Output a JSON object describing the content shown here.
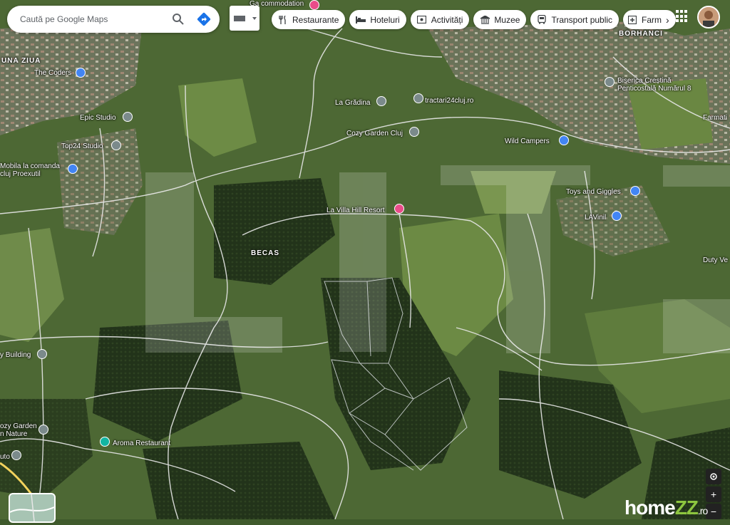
{
  "search": {
    "placeholder": "Caută pe Google Maps"
  },
  "chips": [
    {
      "label": "Restaurante",
      "icon": "fork-knife-icon"
    },
    {
      "label": "Hoteluri",
      "icon": "bed-icon"
    },
    {
      "label": "Activități",
      "icon": "ticket-icon"
    },
    {
      "label": "Muzee",
      "icon": "museum-icon"
    },
    {
      "label": "Transport public",
      "icon": "bus-icon"
    },
    {
      "label": "Farm",
      "icon": "pharmacy-icon"
    }
  ],
  "more_chip_arrow": "›",
  "areas": {
    "una_ziua": "UNA ZIUA",
    "borhanci": "BORHANCI",
    "becas": "BECAS"
  },
  "places": {
    "top_commodation": "Ga commodation",
    "the_coders": "The Coders",
    "epic_studio": "Epic Studio",
    "top24": "Top24 Studio",
    "mobila1": "Mobila la comanda",
    "mobila2": "cluj Proexutil",
    "la_gradina": "La Grădina",
    "tractari": "tractari24cluj.ro",
    "cozy": "Cozy Garden Cluj",
    "biserica1": "Biserica Creștină",
    "biserica2": "Penticostală Numărul 8",
    "farmatia": "Farmati",
    "wild": "Wild Campers",
    "toys": "Toys and Giggles",
    "lavinil": "LAVinil",
    "villa": "La Villa Hill Resort",
    "duty": "Duty Ve",
    "building": "y Building",
    "cozy2a": "ozy Garden",
    "cozy2b": "n Nature",
    "aroma": "Aroma Restaurant",
    "auto": "uto"
  },
  "controls": {
    "zoom_in": "+",
    "zoom_out": "−"
  },
  "watermark": {
    "home": "home",
    "zz": "ZZ",
    "ro": ".ro"
  },
  "colors": {
    "accent_blue": "#1a73e8",
    "pin_pink": "#ea4c89",
    "pin_blue": "#4285f4",
    "pin_gray": "#7b8a8b",
    "pin_teal": "#12b5a2"
  }
}
